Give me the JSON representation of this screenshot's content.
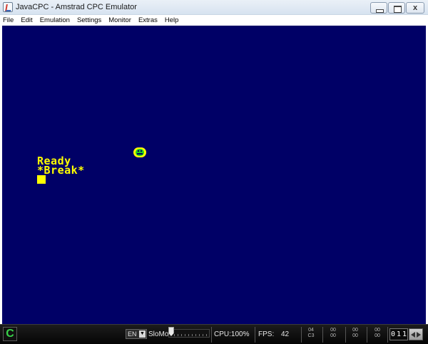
{
  "window": {
    "title": "JavaCPC - Amstrad CPC Emulator",
    "close_glyph": "x",
    "icons": {
      "app": "javacpc-app-icon",
      "minimize": "minimize-icon",
      "maximize": "maximize-icon",
      "close": "close-icon"
    }
  },
  "menu": {
    "items": [
      "File",
      "Edit",
      "Emulation",
      "Settings",
      "Monitor",
      "Extras",
      "Help"
    ]
  },
  "screen": {
    "lines": [
      "Ready",
      "*Break*"
    ],
    "background_color": "#000066",
    "text_color": "#ffff00",
    "sprite": "smiley-sprite-icon"
  },
  "status": {
    "logo_glyph": "C",
    "language": "EN",
    "slomo_label": "SloMo:",
    "cpu_label": "CPU:100%",
    "fps_label": "FPS:",
    "fps_value": "42",
    "registers": [
      [
        "04",
        "C3"
      ],
      [
        "00",
        "00"
      ],
      [
        "00",
        "00"
      ],
      [
        "00",
        "00"
      ]
    ],
    "tape_counter": [
      "0",
      "1",
      "1"
    ],
    "icons": {
      "logo": "cpc-logo-icon",
      "dropdown": "chevron-down-icon",
      "tape": "tape-control-icon"
    }
  }
}
